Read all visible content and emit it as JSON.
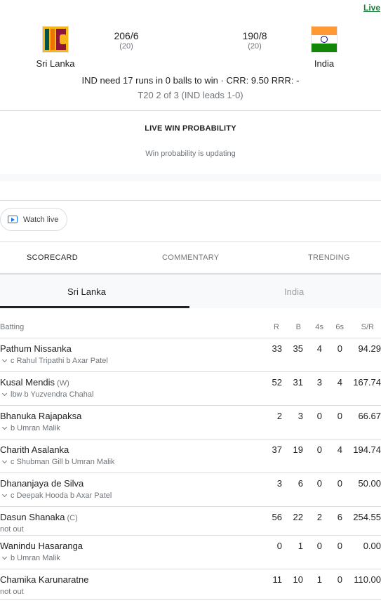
{
  "live_label": "Live",
  "match": {
    "team1": {
      "name": "Sri Lanka",
      "score": "206/6",
      "overs": "(20)"
    },
    "team2": {
      "name": "India",
      "score": "190/8",
      "overs": "(20)"
    },
    "status": "IND need 17 runs in 0 balls to win · CRR: 9.50 RRR: -",
    "series": "T20 2 of 3 (IND leads 1-0)"
  },
  "win_probability": {
    "title": "LIVE WIN PROBABILITY",
    "subtitle": "Win probability is updating"
  },
  "watch_live_label": "Watch live",
  "tabs": [
    "SCORECARD",
    "COMMENTARY",
    "TRENDING"
  ],
  "innings_tabs": [
    "Sri Lanka",
    "India"
  ],
  "columns": {
    "batting": "Batting",
    "r": "R",
    "b": "B",
    "fours": "4s",
    "sixes": "6s",
    "sr": "S/R"
  },
  "batting": [
    {
      "name": "Pathum Nissanka",
      "tag": "",
      "dismissal": "c Rahul Tripathi b Axar Patel",
      "r": "33",
      "b": "35",
      "fours": "4",
      "sixes": "0",
      "sr": "94.29"
    },
    {
      "name": "Kusal Mendis",
      "tag": "(W)",
      "dismissal": "lbw b Yuzvendra Chahal",
      "r": "52",
      "b": "31",
      "fours": "3",
      "sixes": "4",
      "sr": "167.74"
    },
    {
      "name": "Bhanuka Rajapaksa",
      "tag": "",
      "dismissal": "b Umran Malik",
      "r": "2",
      "b": "3",
      "fours": "0",
      "sixes": "0",
      "sr": "66.67"
    },
    {
      "name": "Charith Asalanka",
      "tag": "",
      "dismissal": "c Shubman Gill b Umran Malik",
      "r": "37",
      "b": "19",
      "fours": "0",
      "sixes": "4",
      "sr": "194.74"
    },
    {
      "name": "Dhananjaya de Silva",
      "tag": "",
      "dismissal": "c Deepak Hooda b Axar Patel",
      "r": "3",
      "b": "6",
      "fours": "0",
      "sixes": "0",
      "sr": "50.00"
    },
    {
      "name": "Dasun Shanaka",
      "tag": "(C)",
      "dismissal": "not out",
      "r": "56",
      "b": "22",
      "fours": "2",
      "sixes": "6",
      "sr": "254.55"
    },
    {
      "name": "Wanindu Hasaranga",
      "tag": "",
      "dismissal": "b Umran Malik",
      "r": "0",
      "b": "1",
      "fours": "0",
      "sixes": "0",
      "sr": "0.00"
    },
    {
      "name": "Chamika Karunaratne",
      "tag": "",
      "dismissal": "not out",
      "r": "11",
      "b": "10",
      "fours": "1",
      "sixes": "0",
      "sr": "110.00"
    }
  ]
}
